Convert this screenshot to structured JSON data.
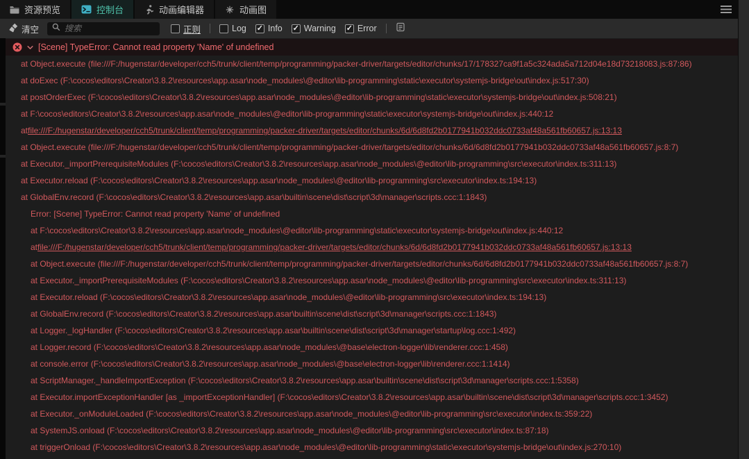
{
  "tabs": [
    {
      "label": "资源预览",
      "icon": "folder-icon",
      "active": false
    },
    {
      "label": "控制台",
      "icon": "terminal-icon",
      "active": true
    },
    {
      "label": "动画编辑器",
      "icon": "runner-icon",
      "active": false
    },
    {
      "label": "动画图",
      "icon": "anim-graph-icon",
      "active": false
    }
  ],
  "window": {
    "menu_icon": "hamburger-menu-icon"
  },
  "toolbar": {
    "clear_label": "清空",
    "search_placeholder": "搜索",
    "search_value": "",
    "regex_filter": {
      "label": "正则",
      "checked": false
    },
    "level_filters": [
      {
        "label": "Log",
        "checked": false
      },
      {
        "label": "Info",
        "checked": true
      },
      {
        "label": "Warning",
        "checked": true
      },
      {
        "label": "Error",
        "checked": true
      }
    ],
    "log_file_icon": "log-file-icon"
  },
  "console": {
    "entry": {
      "severity": "error",
      "expanded": true,
      "message": "[Scene] TypeError: Cannot read property 'Name' of undefined",
      "stack": [
        {
          "indent": 1,
          "text": "at Object.execute (file:///F:/hugenstar/developer/cch5/trunk/client/temp/programming/packer-driver/targets/editor/chunks/17/178327ca9f1a5c324ada5a712d04e18d73218083.js:87:86)"
        },
        {
          "indent": 1,
          "text": "at doExec (F:\\cocos\\editors\\Creator\\3.8.2\\resources\\app.asar\\node_modules\\@editor\\lib-programming\\static\\executor\\systemjs-bridge\\out\\index.js:517:30)"
        },
        {
          "indent": 1,
          "text": "at postOrderExec (F:\\cocos\\editors\\Creator\\3.8.2\\resources\\app.asar\\node_modules\\@editor\\lib-programming\\static\\executor\\systemjs-bridge\\out\\index.js:508:21)"
        },
        {
          "indent": 1,
          "text": "at F:\\cocos\\editors\\Creator\\3.8.2\\resources\\app.asar\\node_modules\\@editor\\lib-programming\\static\\executor\\systemjs-bridge\\out\\index.js:440:12"
        },
        {
          "indent": 1,
          "prefix": "at ",
          "link": "file:///F:/hugenstar/developer/cch5/trunk/client/temp/programming/packer-driver/targets/editor/chunks/6d/6d8fd2b0177941b032ddc0733af48a561fb60657.js:13:13"
        },
        {
          "indent": 1,
          "text": "at Object.execute (file:///F:/hugenstar/developer/cch5/trunk/client/temp/programming/packer-driver/targets/editor/chunks/6d/6d8fd2b0177941b032ddc0733af48a561fb60657.js:8:7)"
        },
        {
          "indent": 1,
          "text": "at Executor._importPrerequisiteModules (F:\\cocos\\editors\\Creator\\3.8.2\\resources\\app.asar\\node_modules\\@editor\\lib-programming\\src\\executor\\index.ts:311:13)"
        },
        {
          "indent": 1,
          "text": "at Executor.reload (F:\\cocos\\editors\\Creator\\3.8.2\\resources\\app.asar\\node_modules\\@editor\\lib-programming\\src\\executor\\index.ts:194:13)"
        },
        {
          "indent": 1,
          "text": "at GlobalEnv.record (F:\\cocos\\editors\\Creator\\3.8.2\\resources\\app.asar\\builtin\\scene\\dist\\script\\3d\\manager\\scripts.ccc:1:1843)"
        },
        {
          "indent": 2,
          "text": "Error: [Scene] TypeError: Cannot read property 'Name' of undefined"
        },
        {
          "indent": 2,
          "text": "at F:\\cocos\\editors\\Creator\\3.8.2\\resources\\app.asar\\node_modules\\@editor\\lib-programming\\static\\executor\\systemjs-bridge\\out\\index.js:440:12"
        },
        {
          "indent": 2,
          "prefix": "at ",
          "link": "file:///F:/hugenstar/developer/cch5/trunk/client/temp/programming/packer-driver/targets/editor/chunks/6d/6d8fd2b0177941b032ddc0733af48a561fb60657.js:13:13"
        },
        {
          "indent": 2,
          "text": "at Object.execute (file:///F:/hugenstar/developer/cch5/trunk/client/temp/programming/packer-driver/targets/editor/chunks/6d/6d8fd2b0177941b032ddc0733af48a561fb60657.js:8:7)"
        },
        {
          "indent": 2,
          "text": "at Executor._importPrerequisiteModules (F:\\cocos\\editors\\Creator\\3.8.2\\resources\\app.asar\\node_modules\\@editor\\lib-programming\\src\\executor\\index.ts:311:13)"
        },
        {
          "indent": 2,
          "text": "at Executor.reload (F:\\cocos\\editors\\Creator\\3.8.2\\resources\\app.asar\\node_modules\\@editor\\lib-programming\\src\\executor\\index.ts:194:13)"
        },
        {
          "indent": 2,
          "text": "at GlobalEnv.record (F:\\cocos\\editors\\Creator\\3.8.2\\resources\\app.asar\\builtin\\scene\\dist\\script\\3d\\manager\\scripts.ccc:1:1843)"
        },
        {
          "indent": 2,
          "text": "at Logger._logHandler (F:\\cocos\\editors\\Creator\\3.8.2\\resources\\app.asar\\builtin\\scene\\dist\\script\\3d\\manager\\startup\\log.ccc:1:492)"
        },
        {
          "indent": 2,
          "text": "at Logger.record (F:\\cocos\\editors\\Creator\\3.8.2\\resources\\app.asar\\node_modules\\@base\\electron-logger\\lib\\renderer.ccc:1:458)"
        },
        {
          "indent": 2,
          "text": "at console.error (F:\\cocos\\editors\\Creator\\3.8.2\\resources\\app.asar\\node_modules\\@base\\electron-logger\\lib\\renderer.ccc:1:1414)"
        },
        {
          "indent": 2,
          "text": "at ScriptManager._handleImportException (F:\\cocos\\editors\\Creator\\3.8.2\\resources\\app.asar\\builtin\\scene\\dist\\script\\3d\\manager\\scripts.ccc:1:5358)"
        },
        {
          "indent": 2,
          "text": "at Executor.importExceptionHandler [as _importExceptionHandler] (F:\\cocos\\editors\\Creator\\3.8.2\\resources\\app.asar\\builtin\\scene\\dist\\script\\3d\\manager\\scripts.ccc:1:3452)"
        },
        {
          "indent": 2,
          "text": "at Executor._onModuleLoaded (F:\\cocos\\editors\\Creator\\3.8.2\\resources\\app.asar\\node_modules\\@editor\\lib-programming\\src\\executor\\index.ts:359:22)"
        },
        {
          "indent": 2,
          "text": "at SystemJS.onload (F:\\cocos\\editors\\Creator\\3.8.2\\resources\\app.asar\\node_modules\\@editor\\lib-programming\\src\\executor\\index.ts:87:18)"
        },
        {
          "indent": 2,
          "text": "at triggerOnload (F:\\cocos\\editors\\Creator\\3.8.2\\resources\\app.asar\\node_modules\\@editor\\lib-programming\\static\\executor\\systemjs-bridge\\out\\index.js:270:10)"
        }
      ]
    }
  },
  "colors": {
    "tabbar_bg": "#0b0b0b",
    "tab_active_text": "#4fc1aa",
    "toolbar_bg": "#2b2b2b",
    "console_bg": "#1d1d1d",
    "error_summary_text": "#ef6a6e",
    "error_stack_text": "#d2595d",
    "error_icon": "#e25b5e",
    "entry_row_bg": "#1b1213"
  }
}
